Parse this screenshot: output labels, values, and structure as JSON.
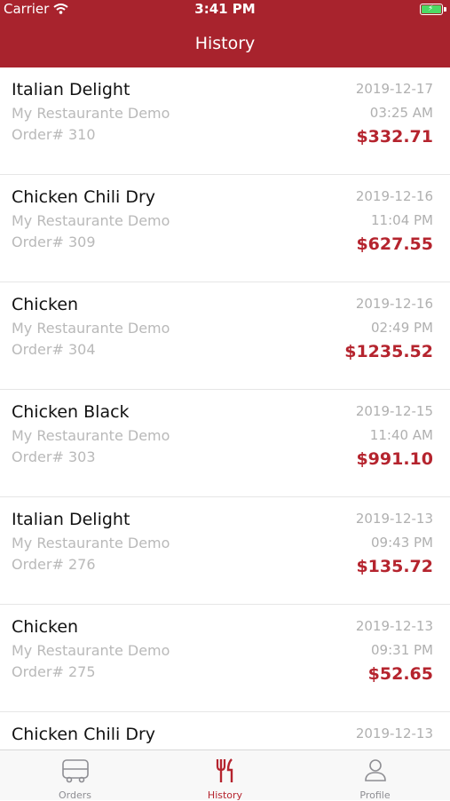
{
  "status_bar": {
    "carrier": "Carrier",
    "time": "3:41 PM"
  },
  "header": {
    "title": "History"
  },
  "orders": [
    {
      "title": "Italian Delight",
      "restaurant": "My Restaurante Demo",
      "order": "Order# 310",
      "date": "2019-12-17",
      "time": "03:25 AM",
      "amount": "$332.71"
    },
    {
      "title": "Chicken Chili Dry",
      "restaurant": "My Restaurante Demo",
      "order": "Order# 309",
      "date": "2019-12-16",
      "time": "11:04 PM",
      "amount": "$627.55"
    },
    {
      "title": "Chicken",
      "restaurant": "My Restaurante Demo",
      "order": "Order# 304",
      "date": "2019-12-16",
      "time": "02:49 PM",
      "amount": "$1235.52"
    },
    {
      "title": "Chicken Black",
      "restaurant": "My Restaurante Demo",
      "order": "Order# 303",
      "date": "2019-12-15",
      "time": "11:40 AM",
      "amount": "$991.10"
    },
    {
      "title": "Italian Delight",
      "restaurant": "My Restaurante Demo",
      "order": "Order# 276",
      "date": "2019-12-13",
      "time": "09:43 PM",
      "amount": "$135.72"
    },
    {
      "title": "Chicken",
      "restaurant": "My Restaurante Demo",
      "order": "Order# 275",
      "date": "2019-12-13",
      "time": "09:31 PM",
      "amount": "$52.65"
    },
    {
      "title": "Chicken Chili Dry",
      "date": "2019-12-13"
    }
  ],
  "tabs": [
    {
      "label": "Orders",
      "icon": "van-icon"
    },
    {
      "label": "History",
      "icon": "fork-knife-icon",
      "active": true
    },
    {
      "label": "Profile",
      "icon": "person-icon"
    }
  ],
  "colors": {
    "brand": "#a8232d",
    "amount": "#b5242e",
    "muted": "#b9b9b9"
  }
}
